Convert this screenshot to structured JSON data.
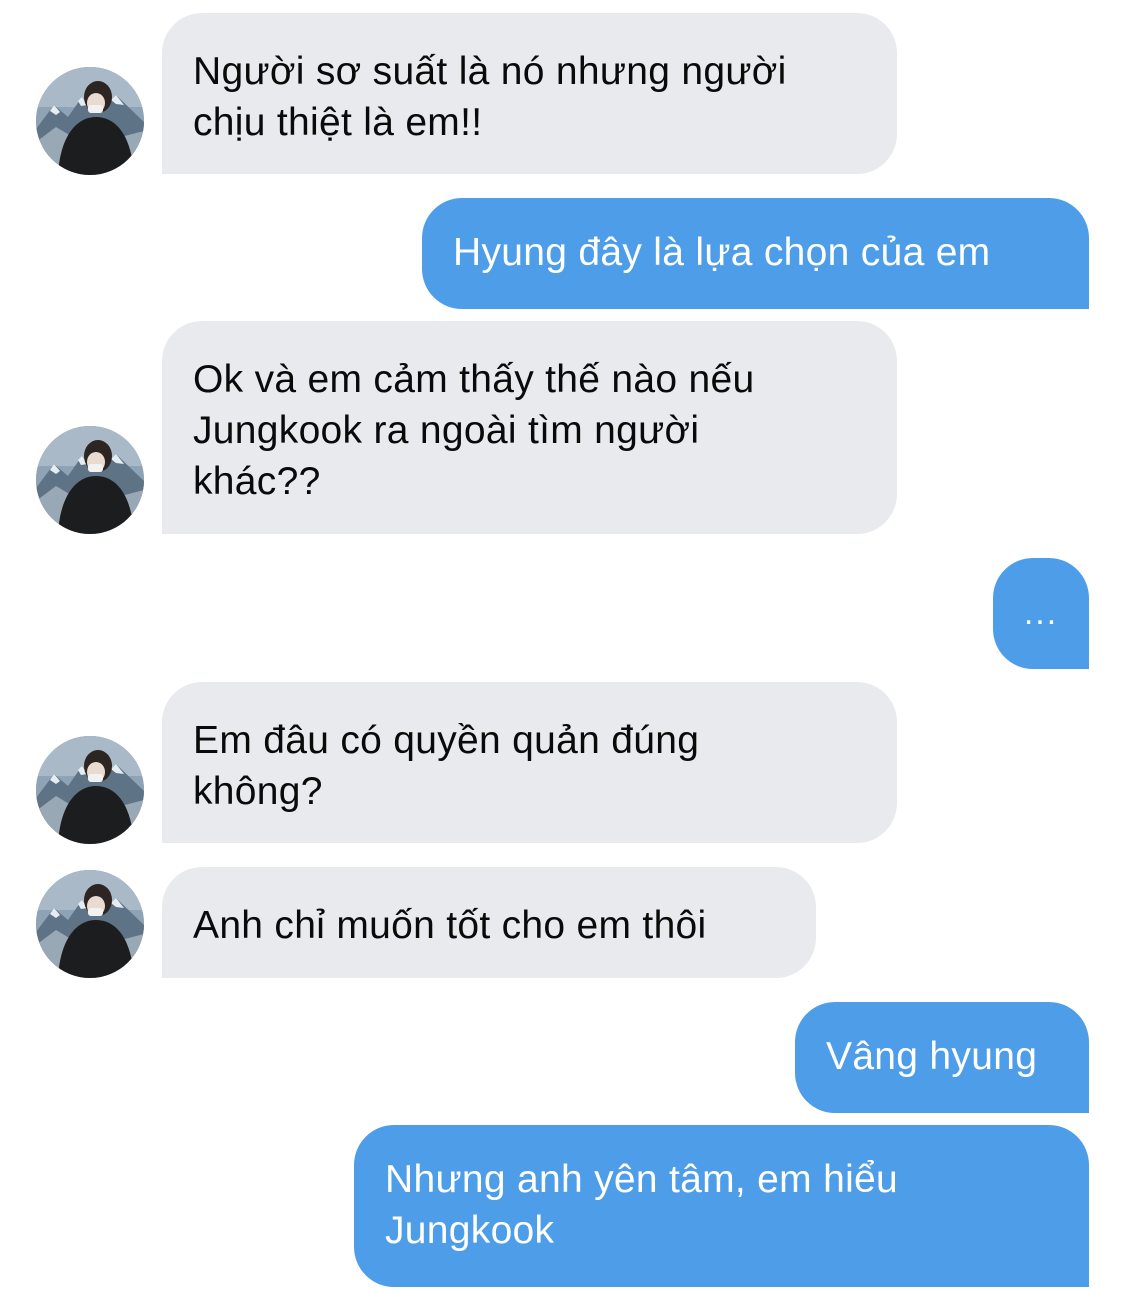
{
  "conversation": {
    "messages": [
      {
        "text": "Người sơ suất là nó nhưng người\nchịu thiệt là em!!"
      },
      {
        "text": "Hyung đây là lựa chọn của em"
      },
      {
        "text": "Ok và em cảm thấy thế nào nếu\nJungkook ra ngoài tìm người\nkhác??"
      },
      {
        "text": "..."
      },
      {
        "text": "Em đâu có quyền quản đúng\nkhông?"
      },
      {
        "text": "Anh chỉ muốn tốt cho em thôi"
      },
      {
        "text": "Vâng hyung"
      },
      {
        "text": "Nhưng anh yên tâm, em hiểu\nJungkook"
      }
    ]
  },
  "colors": {
    "incoming_bubble": "#e9eaee",
    "outgoing_bubble": "#4e9de8",
    "incoming_text": "#0a0a0a",
    "outgoing_text": "#ffffff"
  },
  "icons": {
    "avatar": "contact-avatar-mountain-photo"
  }
}
